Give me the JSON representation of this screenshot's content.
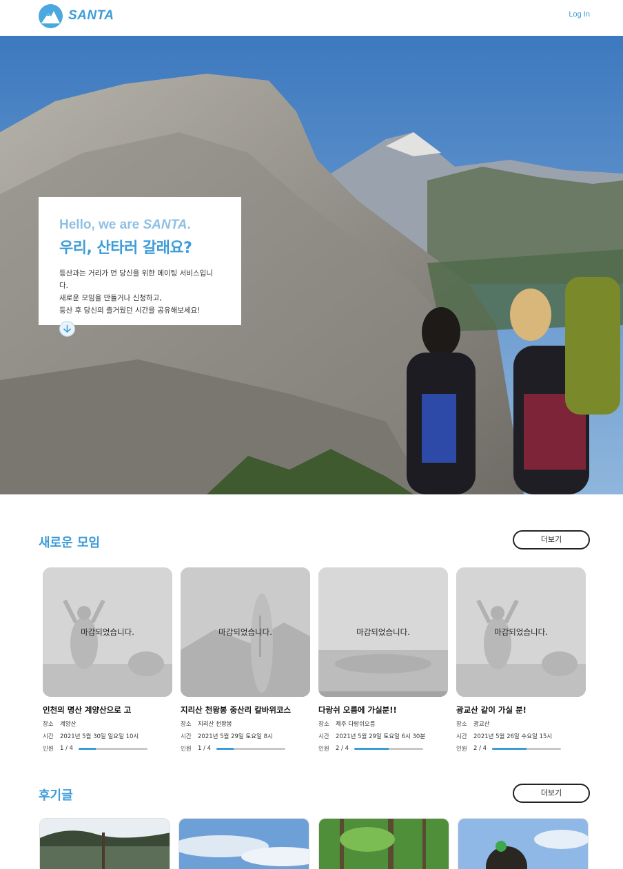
{
  "header": {
    "logo_text": "SANTA",
    "login_label": "Log In"
  },
  "hero": {
    "hello_prefix": "Hello, we are ",
    "hello_brand": "SANTA",
    "hello_suffix": ".",
    "title": "우리, 산타러 갈래요?",
    "desc_line1": "등산과는 거리가 먼 당신을 위한 메이팅 서비스입니다.",
    "desc_line2": "새로운 모임을 만들거나 신청하고,",
    "desc_line3": "등산 후 당신의 즐거웠던 시간을 공유해보세요!"
  },
  "meetings": {
    "title": "새로운 모임",
    "more_label": "더보기",
    "labels": {
      "place": "장소",
      "time": "시간",
      "people": "인원"
    },
    "items": [
      {
        "closed_label": "마감되었습니다.",
        "title": "인천의 명산 계양산으로 고",
        "place": "계양산",
        "time": "2021년 5월 30일 일요일 10시",
        "people": "1 / 4",
        "ratio": 0.25
      },
      {
        "closed_label": "마감되었습니다.",
        "title": "지리산 천왕봉 중산리 칼바위코스",
        "place": "지리산 천왕봉",
        "time": "2021년 5월 29일 토요일 8시",
        "people": "1 / 4",
        "ratio": 0.25
      },
      {
        "closed_label": "마감되었습니다.",
        "title": "다랑쉬 오름에 가실분!!",
        "place": "제주 다랑쉬오름",
        "time": "2021년 5월 29일 토요일 6시 30분",
        "people": "2 / 4",
        "ratio": 0.5
      },
      {
        "closed_label": "마감되었습니다.",
        "title": "광교산 같이 가실 분!",
        "place": "광교산",
        "time": "2021년 5월 26일 수요일 15시",
        "people": "2 / 4",
        "ratio": 0.5
      }
    ]
  },
  "reviews": {
    "title": "후기글",
    "more_label": "더보기"
  },
  "colors": {
    "brand": "#3d9cd8",
    "brand_light": "#8fc0e4"
  }
}
